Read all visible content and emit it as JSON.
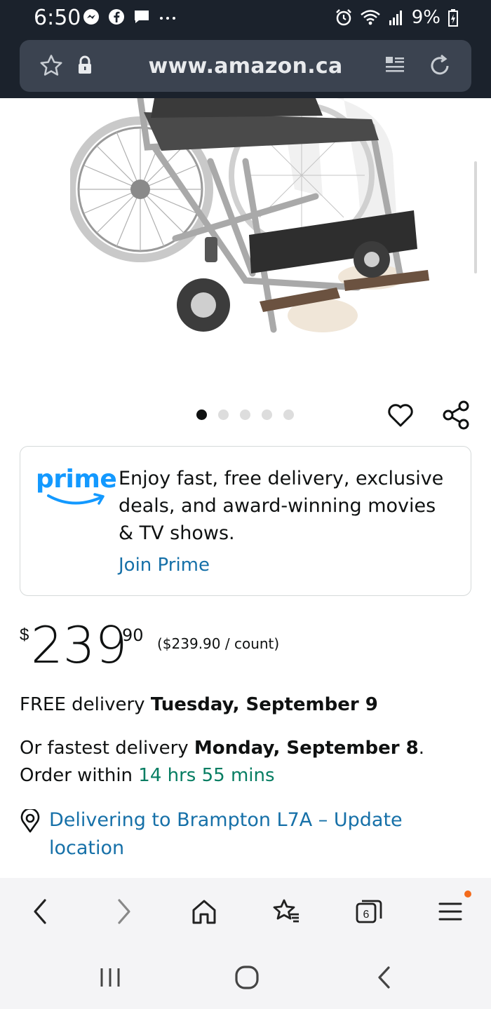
{
  "status_bar": {
    "time": "6:50",
    "battery": "9%",
    "left_icons": [
      "messenger-icon",
      "facebook-icon",
      "chat-icon",
      "more-dots-icon"
    ],
    "right_icons": [
      "alarm-icon",
      "wifi-icon",
      "signal-icon",
      "battery-icon"
    ]
  },
  "browser": {
    "url": "www.amazon.ca"
  },
  "product": {
    "image_alt": "wheelchair",
    "carousel_total": 5,
    "carousel_active": 1
  },
  "prime": {
    "logo": "prime",
    "description": "Enjoy fast, free delivery, exclusive deals, and award-winning movies & TV shows.",
    "join": "Join Prime"
  },
  "price": {
    "symbol": "$",
    "whole": "239",
    "fraction": "90",
    "unit_price": "($239.90 / count)"
  },
  "delivery": {
    "free_prefix": "FREE delivery ",
    "free_date": "Tuesday, September 9",
    "fast_prefix": "Or fastest delivery ",
    "fast_date": "Monday, September 8",
    "order_text": ". Order within ",
    "countdown": "14 hrs 55 mins",
    "location": "Delivering to Brampton L7A – Update location"
  },
  "colors": {
    "status_bg": "#1b222c",
    "prime_blue": "#1399ff",
    "link_blue": "#1670a8",
    "teal": "#067d62"
  }
}
